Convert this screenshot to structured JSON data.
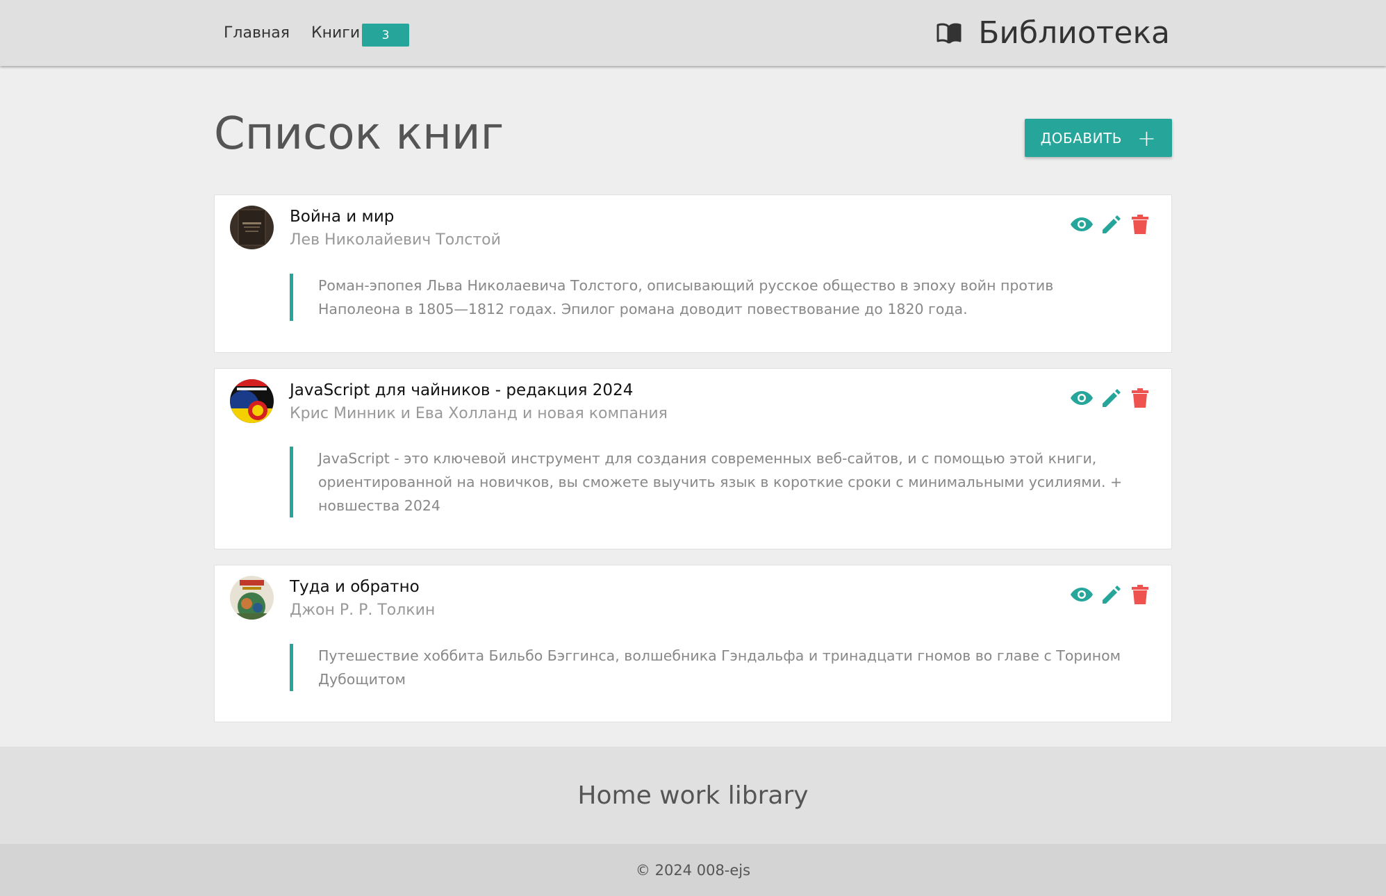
{
  "nav": {
    "home": "Главная",
    "books": "Книги",
    "books_count": "3",
    "brand": "Библиотека",
    "brand_icon": "open-book-icon"
  },
  "header": {
    "title": "Список книг",
    "add_label": "ДОБАВИТЬ",
    "add_icon": "plus-icon"
  },
  "books": [
    {
      "title": "Война и мир",
      "author": "Лев Николайевич Толстой",
      "description": "Роман-эпопея Льва Николаевича Толстого, описывающий русское общество в эпоху войн против Наполеона в 1805—1812 годах. Эпилог романа доводит повествование до 1820 года."
    },
    {
      "title": "JavaScript для чайников - редакция 2024",
      "author": "Крис Минник и Ева Холланд и новая компания",
      "description": "JavaScript - это ключевой инструмент для создания современных веб-сайтов, и с помощью этой книги, ориентированной на новичков, вы сможете выучить язык в короткие сроки с минимальными усилиями. + новшества 2024"
    },
    {
      "title": "Туда и обратно",
      "author": "Джон Р. Р. Толкин",
      "description": "Путешествие хоббита Бильбо Бэггинса, волшебника Гэндальфа и тринадцати гномов во главе с Торином Дубощитом"
    }
  ],
  "actions": {
    "view_icon": "eye-icon",
    "edit_icon": "pencil-icon",
    "delete_icon": "trash-icon"
  },
  "colors": {
    "accent": "#26a69a",
    "danger": "#ef5350",
    "nav_bg": "#e0e0e0",
    "page_bg": "#eeeeee"
  },
  "footer": {
    "title": "Home work library",
    "copyright": "© 2024 008-ejs"
  }
}
